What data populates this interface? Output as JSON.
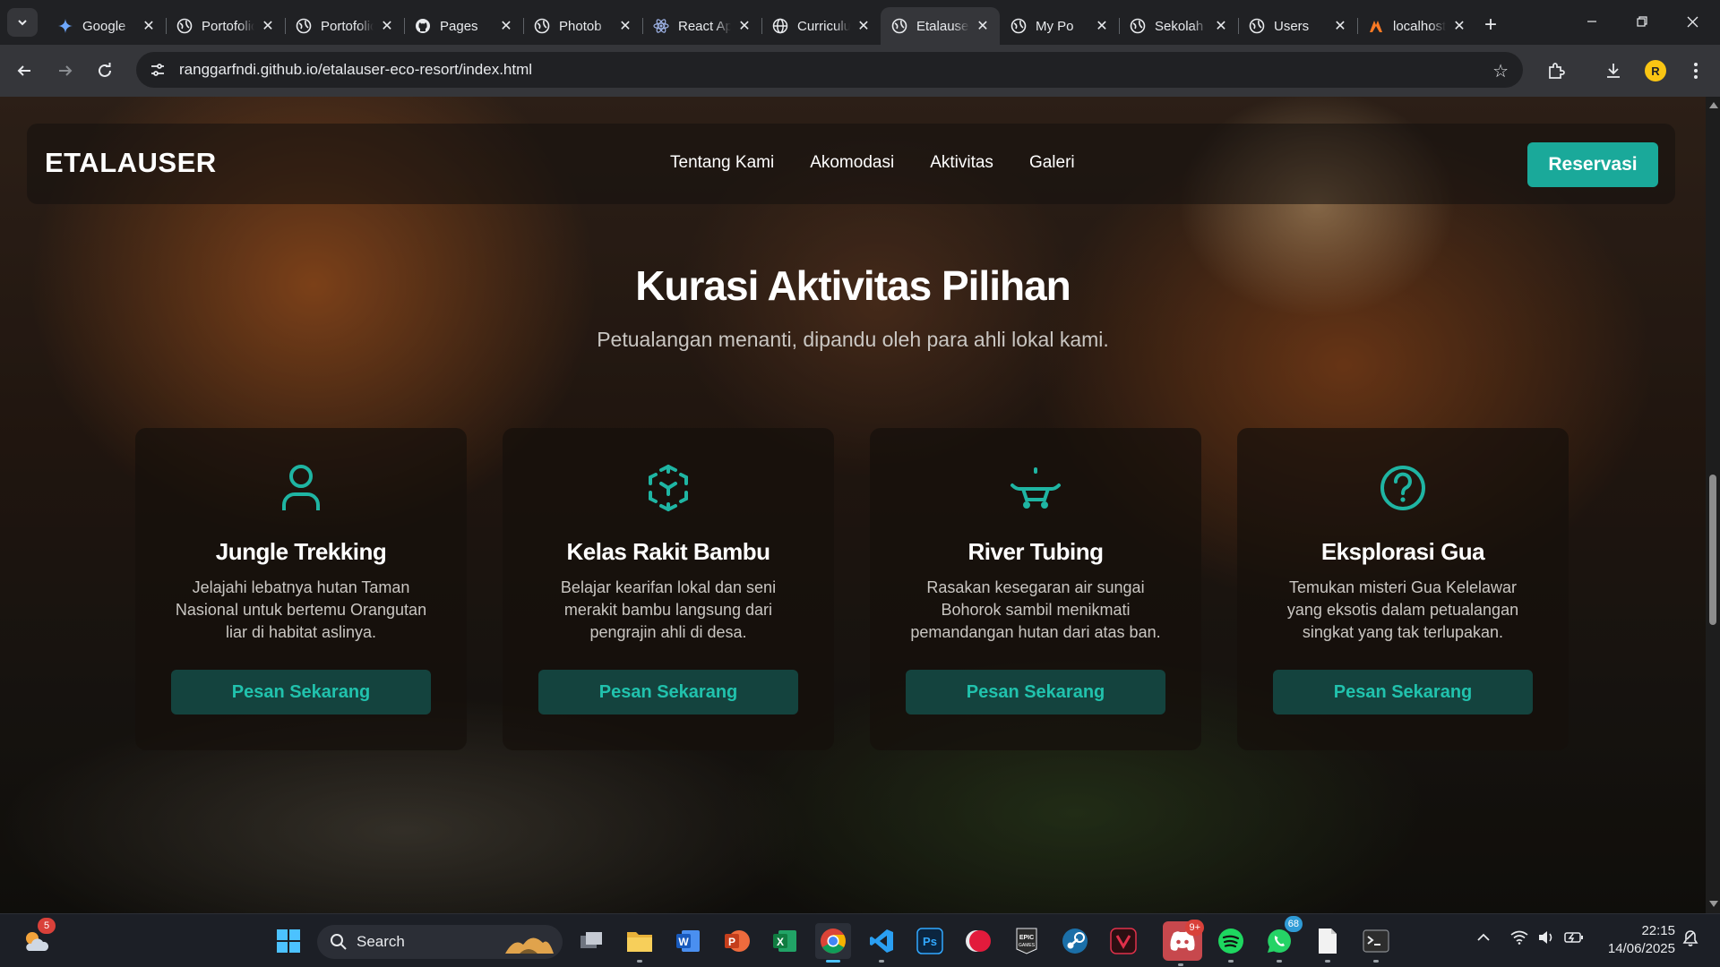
{
  "browser": {
    "tabs": [
      {
        "title": "Google",
        "icon": "gemini-icon",
        "active": false
      },
      {
        "title": "Portofolio",
        "icon": "globe-icon",
        "active": false
      },
      {
        "title": "Portofolio",
        "icon": "globe-icon",
        "active": false
      },
      {
        "title": "Pages",
        "icon": "github-icon",
        "active": false
      },
      {
        "title": "Photob",
        "icon": "globe-icon",
        "active": false
      },
      {
        "title": "React App",
        "icon": "react-icon",
        "active": false
      },
      {
        "title": "Curriculum",
        "icon": "world-icon",
        "active": false
      },
      {
        "title": "Etalauser",
        "icon": "globe-icon",
        "active": true
      },
      {
        "title": "My Po",
        "icon": "globe-icon",
        "active": false
      },
      {
        "title": "Sekolah",
        "icon": "globe-icon",
        "active": false
      },
      {
        "title": "Users",
        "icon": "globe-icon",
        "active": false
      },
      {
        "title": "localhost",
        "icon": "xampp-icon",
        "active": false
      }
    ],
    "url": "ranggarfndi.github.io/etalauser-eco-resort/index.html",
    "profile_initial": "R"
  },
  "site": {
    "brand": "ETALAUSER",
    "nav": [
      "Tentang Kami",
      "Akomodasi",
      "Aktivitas",
      "Galeri"
    ],
    "reserve_label": "Reservasi",
    "section_title": "Kurasi Aktivitas Pilihan",
    "section_subtitle": "Petualangan menanti, dipandu oleh para ahli lokal kami.",
    "cards": [
      {
        "title": "Jungle Trekking",
        "desc": "Jelajahi lebatnya hutan Taman Nasional untuk bertemu Orangutan liar di habitat aslinya.",
        "button": "Pesan Sekarang",
        "icon": "person-icon"
      },
      {
        "title": "Kelas Rakit Bambu",
        "desc": "Belajar kearifan lokal dan seni merakit bambu langsung dari pengrajin ahli di desa.",
        "button": "Pesan Sekarang",
        "icon": "cube-icon"
      },
      {
        "title": "River Tubing",
        "desc": "Rasakan kesegaran air sungai Bohorok sambil menikmati pemandangan hutan dari atas ban.",
        "button": "Pesan Sekarang",
        "icon": "boat-icon"
      },
      {
        "title": "Eksplorasi Gua",
        "desc": "Temukan misteri Gua Kelelawar yang eksotis dalam petualangan singkat yang tak terlupakan.",
        "button": "Pesan Sekarang",
        "icon": "question-circle-icon"
      }
    ],
    "accent_color": "#1aa99a"
  },
  "taskbar": {
    "search_label": "Search",
    "weather_badge": "5",
    "discord_badge": "9+",
    "whatsapp_badge": "68",
    "time": "22:15",
    "date": "14/06/2025"
  }
}
